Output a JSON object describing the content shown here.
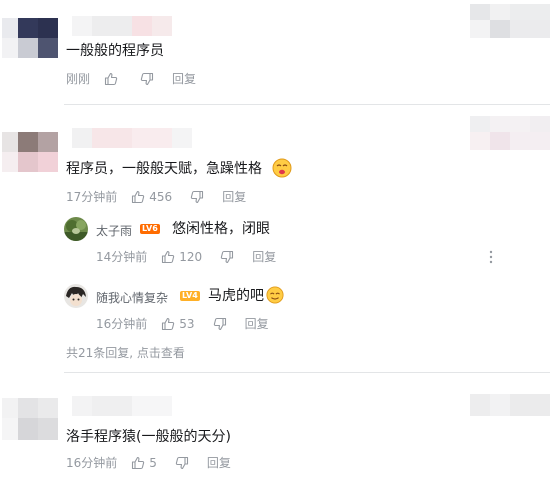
{
  "comments": [
    {
      "text": "一般般的程序员",
      "time": "刚刚",
      "like_count": "",
      "reply_label": "回复"
    },
    {
      "text": "程序员，一般般天赋，急躁性格",
      "time": "17分钟前",
      "like_count": "456",
      "reply_label": "回复",
      "replies": [
        {
          "username": "太子雨",
          "level": "LV6",
          "text": "悠闲性格，闭眼",
          "time": "14分钟前",
          "like_count": "120",
          "reply_label": "回复"
        },
        {
          "username": "随我心情复杂",
          "level": "LV4",
          "text": "马虎的吧",
          "time": "16分钟前",
          "like_count": "53",
          "reply_label": "回复"
        }
      ],
      "view_more": "共21条回复, 点击查看"
    },
    {
      "text": "洛手程序猿(一般般的天分)",
      "time": "16分钟前",
      "like_count": "5",
      "reply_label": "回复"
    }
  ],
  "colors": {
    "lv6": "#ff6c00",
    "lv4": "#ffb027",
    "meta": "#9499a0",
    "divider": "#e3e5e7"
  },
  "icons": {
    "like": "thumbs-up-icon",
    "dislike": "thumbs-down-icon",
    "more": "more-dots-icon"
  }
}
